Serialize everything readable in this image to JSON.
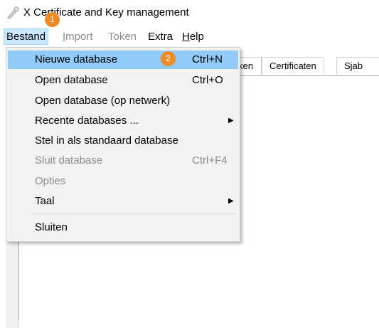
{
  "window": {
    "title": "X Certificate and Key management",
    "icon": "key-pen-icon"
  },
  "menubar": {
    "items": [
      {
        "label": "Bestand",
        "state": "open"
      },
      {
        "label": "Import",
        "state": "disabled"
      },
      {
        "label": "Token",
        "state": "disabled"
      },
      {
        "label": "Extra",
        "state": "normal"
      },
      {
        "label": "Help",
        "state": "normal"
      }
    ]
  },
  "tabs": [
    {
      "label": "ken"
    },
    {
      "label": "Certificaten"
    },
    {
      "label": "Sjab"
    }
  ],
  "file_menu": {
    "items": [
      {
        "label": "Nieuwe database",
        "shortcut": "Ctrl+N",
        "highlighted": true
      },
      {
        "label": "Open database",
        "shortcut": "Ctrl+O"
      },
      {
        "label": "Open database (op netwerk)",
        "shortcut": ""
      },
      {
        "label": "Recente databases ...",
        "shortcut": "",
        "submenu": true
      },
      {
        "label": "Stel in als standaard database",
        "shortcut": ""
      },
      {
        "label": "Sluit database",
        "shortcut": "Ctrl+F4",
        "disabled": true
      },
      {
        "label": "Opties",
        "shortcut": "",
        "disabled": true
      },
      {
        "label": "Taal",
        "shortcut": "",
        "submenu": true
      },
      {
        "label": "Sluiten",
        "shortcut": ""
      }
    ]
  },
  "annotations": [
    {
      "number": "1",
      "color": "#f08a24"
    },
    {
      "number": "2",
      "color": "#f08a24"
    }
  ],
  "colors": {
    "highlight": "#91c9f7",
    "menu_active": "#cce8ff",
    "menu_bg": "#f2f2f2",
    "badge": "#f08a24"
  }
}
